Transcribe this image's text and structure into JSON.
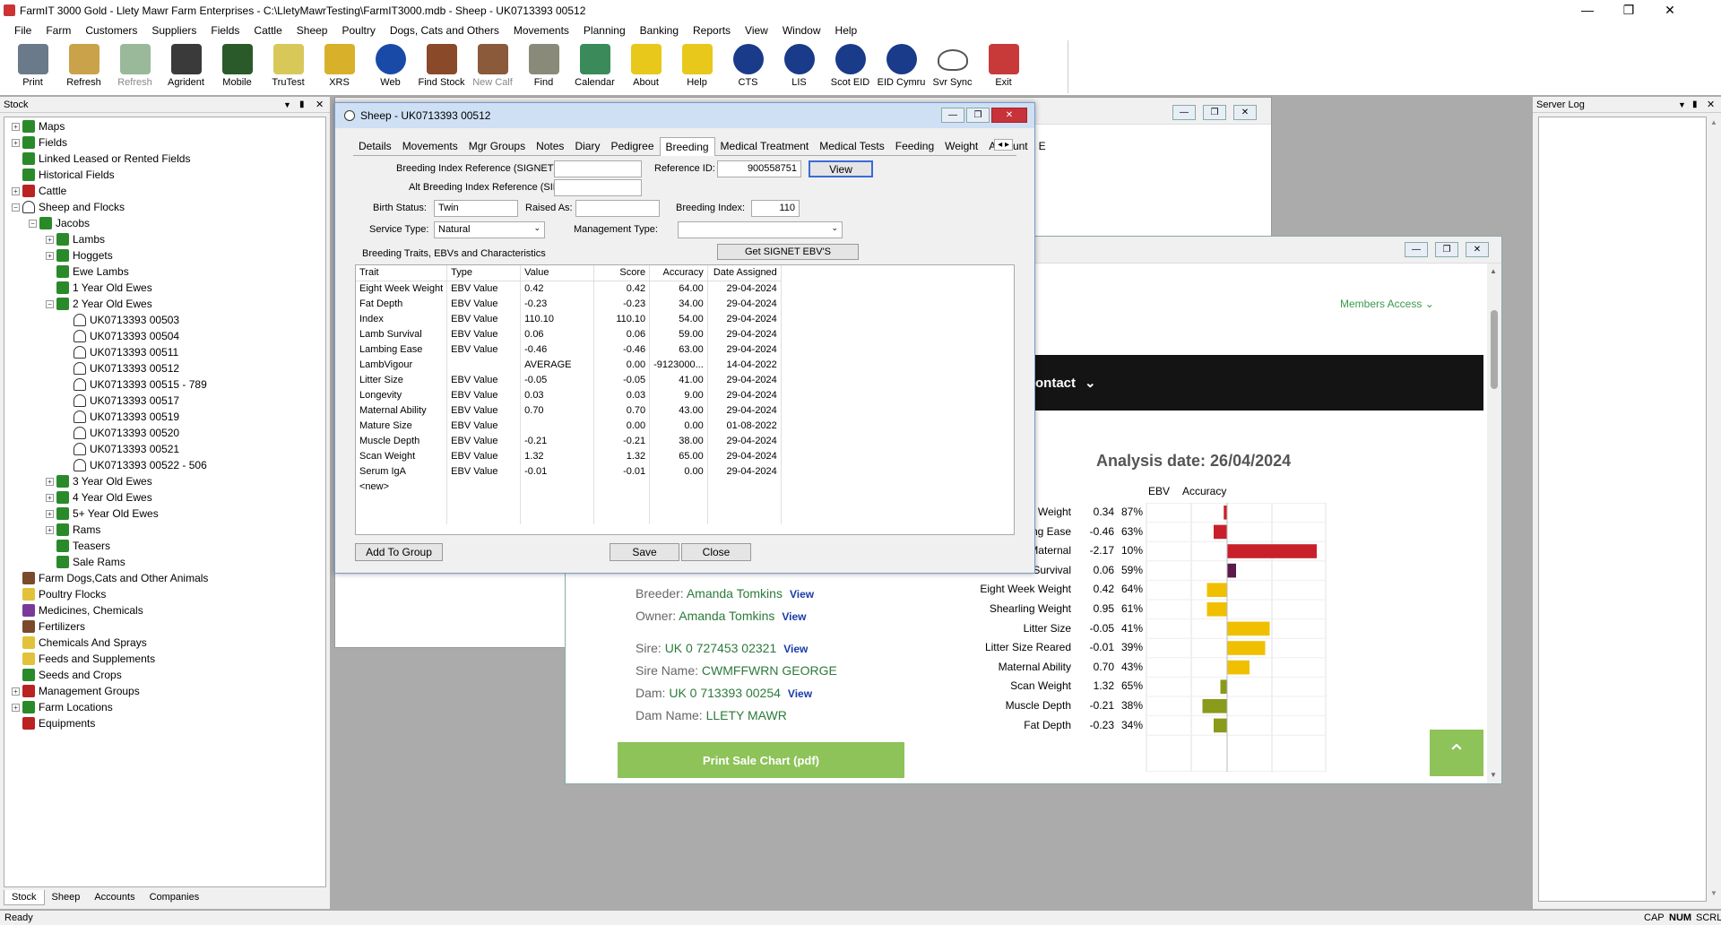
{
  "app": {
    "title": "FarmIT 3000 Gold - Llety Mawr Farm Enterprises - C:\\LletyMawrTesting\\FarmIT3000.mdb - Sheep - UK0713393 00512"
  },
  "menu": [
    "File",
    "Farm",
    "Customers",
    "Suppliers",
    "Fields",
    "Cattle",
    "Sheep",
    "Poultry",
    "Dogs, Cats and Others",
    "Movements",
    "Planning",
    "Banking",
    "Reports",
    "View",
    "Window",
    "Help"
  ],
  "toolbar": [
    {
      "label": "Print",
      "icon": "printer-icon",
      "color": "#6a7a8a"
    },
    {
      "label": "Refresh",
      "icon": "refresh-icon",
      "color": "#c9a24a"
    },
    {
      "label": "Refresh",
      "icon": "refresh-disabled-icon",
      "color": "#9ab89a",
      "disabled": true
    },
    {
      "label": "Agrident",
      "icon": "reader-icon",
      "color": "#3a3a3a"
    },
    {
      "label": "Mobile",
      "icon": "mobile-icon",
      "color": "#2a5a2a"
    },
    {
      "label": "TruTest",
      "icon": "trutest-icon",
      "color": "#d8c85a"
    },
    {
      "label": "XRS",
      "icon": "wand-icon",
      "color": "#d8b02a"
    },
    {
      "label": "Web",
      "icon": "globe-icon",
      "color": "#1a4aa8"
    },
    {
      "label": "Find Stock",
      "icon": "cow-icon",
      "color": "#8a4a2a"
    },
    {
      "label": "New Calf",
      "icon": "calf-icon",
      "color": "#8a5a3a",
      "disabled": true
    },
    {
      "label": "Find",
      "icon": "goat-icon",
      "color": "#8a8a7a"
    },
    {
      "label": "Calendar",
      "icon": "calendar-icon",
      "color": "#3a8a5a"
    },
    {
      "label": "About",
      "icon": "question-icon",
      "color": "#e8c81a"
    },
    {
      "label": "Help",
      "icon": "help-icon",
      "color": "#e8c81a"
    },
    {
      "label": "CTS",
      "icon": "cts-globe-icon",
      "color": "#1a3a8a"
    },
    {
      "label": "LIS",
      "icon": "lis-globe-icon",
      "color": "#1a3a8a"
    },
    {
      "label": "Scot EID",
      "icon": "scot-globe-icon",
      "color": "#1a3a8a"
    },
    {
      "label": "EID Cymru",
      "icon": "cymru-globe-icon",
      "color": "#1a3a8a"
    },
    {
      "label": "Svr Sync",
      "icon": "cloud-icon",
      "color": "#ffffff"
    },
    {
      "label": "Exit",
      "icon": "exit-icon",
      "color": "#c83a3a"
    }
  ],
  "stock_panel": {
    "title": "Stock",
    "tree": [
      {
        "label": "Maps",
        "level": 0,
        "exp": "+",
        "icon": "green"
      },
      {
        "label": "Fields",
        "level": 0,
        "exp": "+",
        "icon": "green"
      },
      {
        "label": "Linked Leased or Rented Fields",
        "level": 0,
        "exp": "",
        "icon": "green"
      },
      {
        "label": "Historical Fields",
        "level": 0,
        "exp": "",
        "icon": "green"
      },
      {
        "label": "Cattle",
        "level": 0,
        "exp": "+",
        "icon": "red"
      },
      {
        "label": "Sheep and Flocks",
        "level": 0,
        "exp": "-",
        "icon": "sheep"
      },
      {
        "label": "Jacobs",
        "level": 1,
        "exp": "-",
        "icon": "green"
      },
      {
        "label": "Lambs",
        "level": 2,
        "exp": "+",
        "icon": "green"
      },
      {
        "label": "Hoggets",
        "level": 2,
        "exp": "+",
        "icon": "green"
      },
      {
        "label": "Ewe Lambs",
        "level": 2,
        "exp": "",
        "icon": "green"
      },
      {
        "label": "1 Year Old Ewes",
        "level": 2,
        "exp": "",
        "icon": "green"
      },
      {
        "label": "2 Year Old Ewes",
        "level": 2,
        "exp": "-",
        "icon": "green"
      },
      {
        "label": "UK0713393 00503",
        "level": 3,
        "exp": "",
        "icon": "sheep"
      },
      {
        "label": "UK0713393 00504",
        "level": 3,
        "exp": "",
        "icon": "sheep"
      },
      {
        "label": "UK0713393 00511",
        "level": 3,
        "exp": "",
        "icon": "sheep"
      },
      {
        "label": "UK0713393 00512",
        "level": 3,
        "exp": "",
        "icon": "sheep"
      },
      {
        "label": "UK0713393 00515 - 789",
        "level": 3,
        "exp": "",
        "icon": "sheep"
      },
      {
        "label": "UK0713393 00517",
        "level": 3,
        "exp": "",
        "icon": "sheep"
      },
      {
        "label": "UK0713393 00519",
        "level": 3,
        "exp": "",
        "icon": "sheep"
      },
      {
        "label": "UK0713393 00520",
        "level": 3,
        "exp": "",
        "icon": "sheep"
      },
      {
        "label": "UK0713393 00521",
        "level": 3,
        "exp": "",
        "icon": "sheep"
      },
      {
        "label": "UK0713393 00522 - 506",
        "level": 3,
        "exp": "",
        "icon": "sheep"
      },
      {
        "label": "3 Year Old Ewes",
        "level": 2,
        "exp": "+",
        "icon": "green"
      },
      {
        "label": "4 Year Old Ewes",
        "level": 2,
        "exp": "+",
        "icon": "green"
      },
      {
        "label": "5+ Year Old Ewes",
        "level": 2,
        "exp": "+",
        "icon": "green"
      },
      {
        "label": "Rams",
        "level": 2,
        "exp": "+",
        "icon": "green"
      },
      {
        "label": "Teasers",
        "level": 2,
        "exp": "",
        "icon": "green"
      },
      {
        "label": "Sale Rams",
        "level": 2,
        "exp": "",
        "icon": "green"
      },
      {
        "label": "Farm Dogs,Cats and Other Animals",
        "level": 0,
        "exp": "",
        "icon": "brown"
      },
      {
        "label": "Poultry Flocks",
        "level": 0,
        "exp": "",
        "icon": "yellow"
      },
      {
        "label": "Medicines, Chemicals",
        "level": 0,
        "exp": "",
        "icon": "purple"
      },
      {
        "label": "Fertilizers",
        "level": 0,
        "exp": "",
        "icon": "brown"
      },
      {
        "label": "Chemicals And Sprays",
        "level": 0,
        "exp": "",
        "icon": "yellow"
      },
      {
        "label": "Feeds and Supplements",
        "level": 0,
        "exp": "",
        "icon": "yellow"
      },
      {
        "label": "Seeds and Crops",
        "level": 0,
        "exp": "",
        "icon": "green"
      },
      {
        "label": "Management Groups",
        "level": 0,
        "exp": "+",
        "icon": "red"
      },
      {
        "label": "Farm Locations",
        "level": 0,
        "exp": "+",
        "icon": "green"
      },
      {
        "label": "Equipments",
        "level": 0,
        "exp": "",
        "icon": "red"
      }
    ],
    "bottom_tabs": [
      "Stock",
      "Sheep",
      "Accounts",
      "Companies"
    ]
  },
  "server_log": {
    "title": "Server Log"
  },
  "dialog": {
    "title": "Sheep - UK0713393 00512",
    "tabs": [
      "Details",
      "Movements",
      "Mgr Groups",
      "Notes",
      "Diary",
      "Pedigree",
      "Breeding",
      "Medical Treatment",
      "Medical Tests",
      "Feeding",
      "Weight",
      "Account",
      "E"
    ],
    "active_tab": "Breeding",
    "labels": {
      "signet": "Breeding Index Reference (SIGNET):",
      "ref_id": "Reference ID:",
      "sil": "Alt Breeding Index Reference (SIL):",
      "birth_status": "Birth Status:",
      "raised_as": "Raised As:",
      "breeding_index": "Breeding Index:",
      "service_type": "Service Type:",
      "management_type": "Management Type:",
      "traits_caption": "Breeding Traits, EBVs and Characteristics"
    },
    "values": {
      "signet": "",
      "ref_id": "900558751",
      "sil": "",
      "birth_status": "Twin",
      "raised_as": "",
      "breeding_index": "110",
      "service_type": "Natural",
      "management_type": ""
    },
    "buttons": {
      "view": "View",
      "get_signet": "Get SIGNET EBV'S",
      "add_to_group": "Add To Group",
      "save": "Save",
      "close": "Close"
    },
    "columns": [
      "Trait",
      "Type",
      "Value",
      "Score",
      "Accuracy",
      "Date Assigned"
    ],
    "rows": [
      [
        "Eight Week Weight",
        "EBV Value",
        "0.42",
        "0.42",
        "64.00",
        "29-04-2024"
      ],
      [
        "Fat Depth",
        "EBV Value",
        "-0.23",
        "-0.23",
        "34.00",
        "29-04-2024"
      ],
      [
        "Index",
        "EBV Value",
        "110.10",
        "110.10",
        "54.00",
        "29-04-2024"
      ],
      [
        "Lamb Survival",
        "EBV Value",
        "0.06",
        "0.06",
        "59.00",
        "29-04-2024"
      ],
      [
        "Lambing Ease",
        "EBV Value",
        "-0.46",
        "-0.46",
        "63.00",
        "29-04-2024"
      ],
      [
        "LambVigour",
        "",
        "AVERAGE",
        "0.00",
        "-9123000...",
        "14-04-2022"
      ],
      [
        "Litter Size",
        "EBV Value",
        "-0.05",
        "-0.05",
        "41.00",
        "29-04-2024"
      ],
      [
        "Longevity",
        "EBV Value",
        "0.03",
        "0.03",
        "9.00",
        "29-04-2024"
      ],
      [
        "Maternal Ability",
        "EBV Value",
        "0.70",
        "0.70",
        "43.00",
        "29-04-2024"
      ],
      [
        "Mature Size",
        "EBV Value",
        "",
        "0.00",
        "0.00",
        "01-08-2022"
      ],
      [
        "Muscle Depth",
        "EBV Value",
        "-0.21",
        "-0.21",
        "38.00",
        "29-04-2024"
      ],
      [
        "Scan Weight",
        "EBV Value",
        "1.32",
        "1.32",
        "65.00",
        "29-04-2024"
      ],
      [
        "Serum IgA",
        "EBV Value",
        "-0.01",
        "-0.01",
        "0.00",
        "29-04-2024"
      ]
    ],
    "new_row": "<new>"
  },
  "web": {
    "members_access": "Members Access",
    "contact": "ontact",
    "analysis_date": "Analysis date: 26/04/2024",
    "ebv_header": "EBV",
    "accuracy_header": "Accuracy",
    "breeder_label": "Breeder:",
    "breeder": "Amanda Tomkins",
    "owner_label": "Owner:",
    "owner": "Amanda Tomkins",
    "sire_label": "Sire:",
    "sire": "UK 0 727453 02321",
    "sire_name_label": "Sire Name:",
    "sire_name": "CWMFFWRN GEORGE",
    "dam_label": "Dam:",
    "dam": "UK 0 713393 00254",
    "dam_name_label": "Dam Name:",
    "dam_name": "LLETY MAWR",
    "view_link": "View",
    "print_button": "Print Sale Chart (pdf)"
  },
  "chart_data": {
    "type": "bar",
    "categories": [
      "Birth Weight",
      "Lambing Ease",
      "Ease Maternal",
      "Lamb Survival",
      "Eight Week Weight",
      "Shearling Weight",
      "Litter Size",
      "Litter Size Reared",
      "Maternal Ability",
      "Scan Weight",
      "Muscle Depth",
      "Fat Depth"
    ],
    "ebv": [
      "0.34",
      "-0.46",
      "-2.17",
      "0.06",
      "0.42",
      "0.95",
      "-0.05",
      "-0.01",
      "0.70",
      "1.32",
      "-0.21",
      "-0.23"
    ],
    "accuracy": [
      "87%",
      "63%",
      "10%",
      "59%",
      "64%",
      "61%",
      "41%",
      "39%",
      "43%",
      "65%",
      "38%",
      "34%"
    ],
    "bar_values": [
      -0.15,
      -0.6,
      4.0,
      0.4,
      -0.9,
      -0.9,
      1.9,
      1.7,
      1.0,
      -0.3,
      -1.1,
      -0.6
    ],
    "bar_colors": [
      "#c8202a",
      "#c8202a",
      "#c8202a",
      "#5a1a4a",
      "#f0c000",
      "#f0c000",
      "#f0c000",
      "#f0c000",
      "#f0c000",
      "#8a9a1a",
      "#8a9a1a",
      "#8a9a1a"
    ]
  },
  "status": {
    "left": "Ready",
    "right": [
      "CAP",
      "NUM",
      "SCRL"
    ]
  }
}
